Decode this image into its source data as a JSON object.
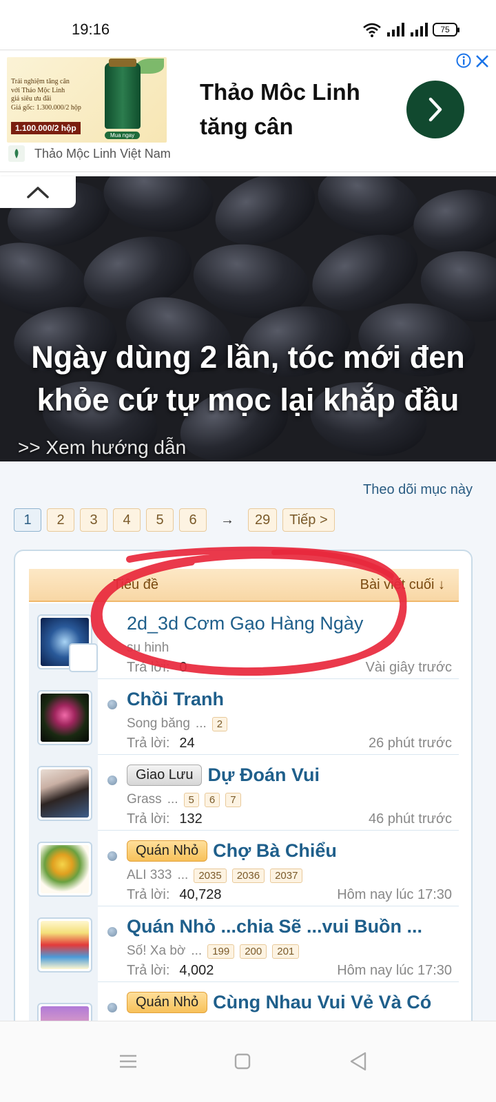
{
  "status_bar": {
    "time": "19:16",
    "battery": "75",
    "icons": [
      "wifi-icon",
      "signal-icon",
      "signal-icon",
      "battery-icon"
    ]
  },
  "ad": {
    "thumb_lines": [
      "Trải nghiệm tăng cân",
      "với Thảo Mộc Linh",
      "giá siêu ưu đãi",
      "Giá gốc: 1.300.000/2 hộp"
    ],
    "thumb_price": "1.100.000/2 hộp",
    "thumb_buy": "Mua ngay",
    "title": "Thảo Môc Linh tăng cân",
    "advertiser": "Thảo Mộc Linh Việt Nam",
    "colors": {
      "button": "#11492f",
      "info": "#1a73e8"
    }
  },
  "hero": {
    "headline_1": "Ngày dùng 2 lần, tóc mới đen",
    "headline_2": "khỏe cứ tự mọc lại khắp đầu",
    "guide": ">> Xem hướng dẫn"
  },
  "forum": {
    "follow_label": "Theo dõi mục này",
    "pagination": {
      "pages": [
        "1",
        "2",
        "3",
        "4",
        "5",
        "6"
      ],
      "current": "1",
      "arrow": "→",
      "last": "29",
      "next": "Tiếp >"
    },
    "columns": {
      "title": "Tiêu đề",
      "last_post": "Bài viết cuối ↓"
    },
    "reply_label": "Trả lời:",
    "threads": [
      {
        "title": "2d_3d Cơm Gạo Hàng Ngày",
        "author": "su hinh",
        "replies": "0",
        "last": "Vài giây trước"
      },
      {
        "title": "Chồi Tranh",
        "author": "Song băng",
        "pages": [
          "2"
        ],
        "replies": "24",
        "last": "26 phút trước"
      },
      {
        "prefix": "Giao Lưu",
        "title": "Dự Đoán Vui",
        "author": "Grass",
        "pages": [
          "5",
          "6",
          "7"
        ],
        "replies": "132",
        "last": "46 phút trước"
      },
      {
        "prefix": "Quán Nhỏ",
        "title": "Chợ Bà Chiểu",
        "author": "ALI 333",
        "pages": [
          "2035",
          "2036",
          "2037"
        ],
        "replies": "40,728",
        "last": "Hôm nay lúc 17:30"
      },
      {
        "title": "Quán Nhỏ ...chia Sẽ ...vui Buồn ...",
        "author": "Số! Xa bờ",
        "pages": [
          "199",
          "200",
          "201"
        ],
        "replies": "4,002",
        "last": "Hôm nay lúc 17:30"
      },
      {
        "prefix": "Quán Nhỏ",
        "title": "Cùng Nhau Vui Vẻ Và Có"
      }
    ],
    "ellipsis": "...",
    "colors": {
      "link": "#1f5f8b",
      "prefix_orange": "#f7c15a",
      "annotation": "#e8283c"
    }
  }
}
